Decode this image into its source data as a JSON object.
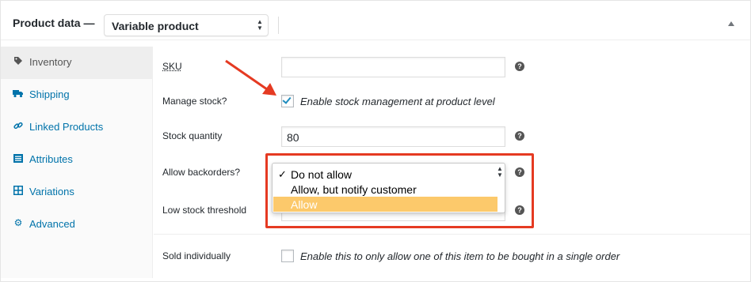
{
  "header": {
    "title": "Product data —",
    "product_type": "Variable product"
  },
  "tabs": [
    {
      "label": "Inventory",
      "icon": "tag-icon",
      "active": true
    },
    {
      "label": "Shipping",
      "icon": "truck-icon",
      "active": false
    },
    {
      "label": "Linked Products",
      "icon": "link-icon",
      "active": false
    },
    {
      "label": "Attributes",
      "icon": "list-icon",
      "active": false
    },
    {
      "label": "Variations",
      "icon": "grid-icon",
      "active": false
    },
    {
      "label": "Advanced",
      "icon": "gear-icon",
      "active": false
    }
  ],
  "fields": {
    "sku": {
      "label": "SKU",
      "value": ""
    },
    "manage_stock": {
      "label": "Manage stock?",
      "checked": true,
      "description": "Enable stock management at product level"
    },
    "stock_quantity": {
      "label": "Stock quantity",
      "value": "80"
    },
    "backorders": {
      "label": "Allow backorders?",
      "options": [
        "Do not allow",
        "Allow, but notify customer",
        "Allow"
      ],
      "selected": "Do not allow",
      "highlighted": "Allow"
    },
    "low_stock": {
      "label": "Low stock threshold",
      "value": ""
    },
    "sold_individually": {
      "label": "Sold individually",
      "checked": false,
      "description": "Enable this to only allow one of this item to be bought in a single order"
    }
  },
  "help_icon_glyph": "?",
  "colors": {
    "link": "#0073aa",
    "annotation_red": "#e53a22",
    "highlight": "#fcc96b",
    "checkmark": "#1e8cbe"
  }
}
